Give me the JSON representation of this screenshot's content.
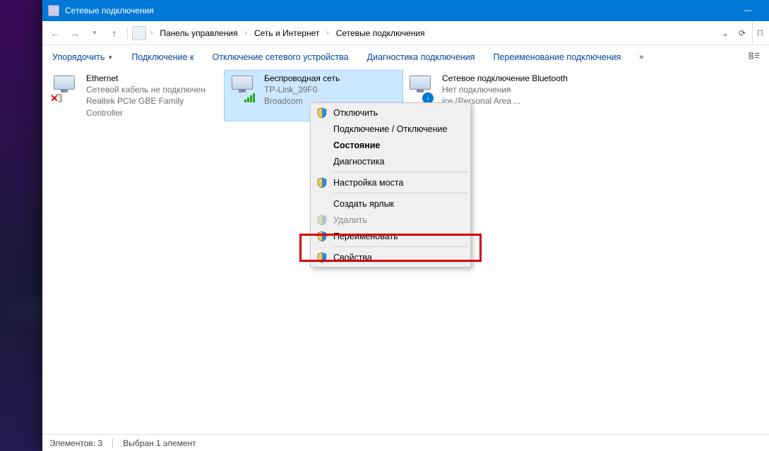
{
  "window": {
    "title": "Сетевые подключения"
  },
  "breadcrumbs": {
    "b0": "Панель управления",
    "b1": "Сеть и Интернет",
    "b2": "Сетевые подключения"
  },
  "toolbar": {
    "organize": "Упорядочить",
    "connect_to": "Подключение к",
    "disable_device": "Отключение сетевого устройства",
    "diagnose": "Диагностика подключения",
    "rename": "Переименование подключения"
  },
  "items": {
    "ethernet": {
      "name": "Ethernet",
      "status": "Сетевой кабель не подключен",
      "device": "Realtek PCIe GBE Family Controller"
    },
    "wifi": {
      "name": "Беспроводная сеть",
      "status": "TP-Link_39F0",
      "device": "Broadcom"
    },
    "bluetooth": {
      "name": "Сетевое подключение Bluetooth",
      "status": "Нет подключения",
      "device": "ice (Personal Area ..."
    }
  },
  "context_menu": {
    "disconnect": "Отключить",
    "connect_disconnect": "Подключение / Отключение",
    "status": "Состояние",
    "diagnostics": "Диагностика",
    "bridge": "Настройка моста",
    "shortcut": "Создать ярлык",
    "delete": "Удалить",
    "rename": "Переименовать",
    "properties": "Свойства"
  },
  "statusbar": {
    "count_label": "Элементов: 3",
    "selection_label": "Выбран 1 элемент"
  }
}
